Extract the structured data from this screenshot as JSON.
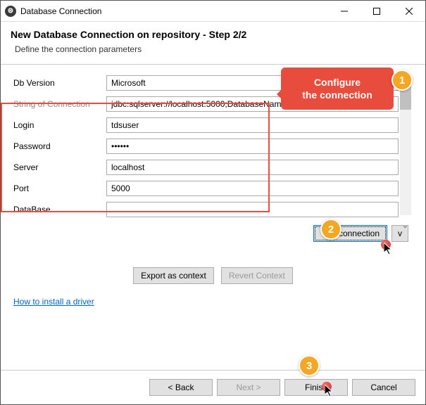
{
  "window": {
    "title": "Database Connection",
    "icon_glyph": "⊜"
  },
  "header": {
    "title": "New Database Connection on repository - Step 2/2",
    "subtitle": "Define the connection parameters"
  },
  "fields": {
    "db_version": {
      "label": "Db Version",
      "value": "Microsoft"
    },
    "conn_string": {
      "label": "String of Connection",
      "value": "jdbc:sqlserver://localhost:5000;DatabaseName="
    },
    "login": {
      "label": "Login",
      "value": "tdsuser"
    },
    "password": {
      "label": "Password",
      "value": "••••••"
    },
    "server": {
      "label": "Server",
      "value": "localhost"
    },
    "port": {
      "label": "Port",
      "value": "5000"
    },
    "database": {
      "label": "DataBase",
      "value": ""
    }
  },
  "buttons": {
    "test_connection": "Test connection",
    "v": "v",
    "export_context": "Export as context",
    "revert_context": "Revert Context",
    "back": "< Back",
    "next": "Next >",
    "finish": "Finish",
    "cancel": "Cancel"
  },
  "link": {
    "install_driver": "How to install a driver"
  },
  "annotations": {
    "callout": "Configure\nthe connection",
    "m1": "1",
    "m2": "2",
    "m3": "3"
  }
}
